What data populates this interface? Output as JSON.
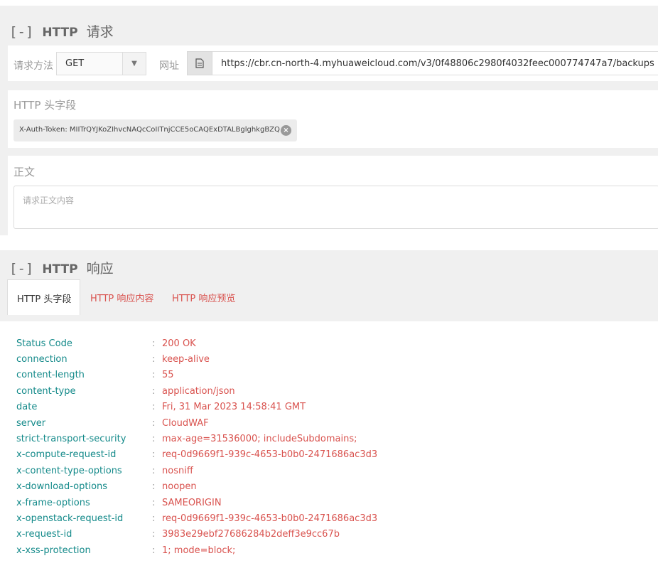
{
  "request": {
    "title_collapse": "[-]",
    "title_http": "HTTP",
    "title_cn": "请求",
    "method_label": "请求方法",
    "method_value": "GET",
    "url_label": "网址",
    "url_value": "https://cbr.cn-north-4.myhuaweicloud.com/v3/0f48806c2980f4032feec000774747a7/backups",
    "headers_label": "HTTP 头字段",
    "header_chip": "X-Auth-Token: MIITrQYJKoZIhvcNAQcCoIITnjCCE5oCAQExDTALBglghkgBZQ...",
    "body_label": "正文",
    "body_placeholder": "请求正文内容"
  },
  "response": {
    "title_collapse": "[-]",
    "title_http": "HTTP",
    "title_cn": "响应",
    "tabs": [
      "HTTP 头字段",
      "HTTP 响应内容",
      "HTTP 响应预览"
    ],
    "separator": ":",
    "headers": [
      {
        "key": "Status Code",
        "value": "200 OK"
      },
      {
        "key": "connection",
        "value": "keep-alive"
      },
      {
        "key": "content-length",
        "value": "55"
      },
      {
        "key": "content-type",
        "value": "application/json"
      },
      {
        "key": "date",
        "value": "Fri, 31 Mar 2023 14:58:41 GMT"
      },
      {
        "key": "server",
        "value": "CloudWAF"
      },
      {
        "key": "strict-transport-security",
        "value": "max-age=31536000; includeSubdomains;"
      },
      {
        "key": "x-compute-request-id",
        "value": "req-0d9669f1-939c-4653-b0b0-2471686ac3d3"
      },
      {
        "key": "x-content-type-options",
        "value": "nosniff"
      },
      {
        "key": "x-download-options",
        "value": "noopen"
      },
      {
        "key": "x-frame-options",
        "value": "SAMEORIGIN"
      },
      {
        "key": "x-openstack-request-id",
        "value": "req-0d9669f1-939c-4653-b0b0-2471686ac3d3"
      },
      {
        "key": "x-request-id",
        "value": "3983e29ebf27686284b2deff3e9cc67b"
      },
      {
        "key": "x-xss-protection",
        "value": "1; mode=block;"
      }
    ]
  },
  "colors": {
    "key": "#148a8a",
    "value": "#d9534f",
    "band": "#f0f0f0"
  }
}
